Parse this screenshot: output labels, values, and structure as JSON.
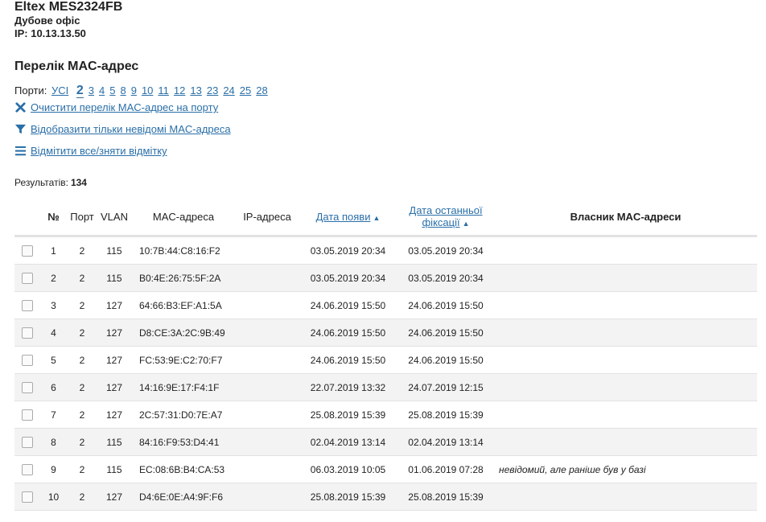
{
  "device": {
    "name": "Eltex MES2324FB",
    "office": "Дубове офіс",
    "ip": "IP: 10.13.13.50"
  },
  "section_title": "Перелік MAC-адрес",
  "ports": {
    "label": "Порти:",
    "all": "УСІ",
    "items": [
      "2",
      "3",
      "4",
      "5",
      "8",
      "9",
      "10",
      "11",
      "12",
      "13",
      "23",
      "24",
      "25",
      "28"
    ]
  },
  "actions": {
    "clear": "Очистити перелік MAC-адрес на порту",
    "filter_unknown": "Відобразити тільки невідомі MAC-адреса",
    "toggle_all": "Відмітити все/зняти відмітку"
  },
  "results": {
    "label": "Результатів:",
    "count": "134"
  },
  "table": {
    "headers": {
      "num": "№",
      "port": "Порт",
      "vlan": "VLAN",
      "mac": "MAC-адреса",
      "ip": "IP-адреса",
      "first_seen": "Дата появи",
      "last_seen_1": "Дата останньої",
      "last_seen_2": "фіксації",
      "owner": "Власник MAC-адреси"
    },
    "rows": [
      {
        "n": "1",
        "port": "2",
        "vlan": "115",
        "mac": "10:7B:44:C8:16:F2",
        "ip": "",
        "first": "03.05.2019 20:34",
        "last": "03.05.2019 20:34",
        "owner": ""
      },
      {
        "n": "2",
        "port": "2",
        "vlan": "115",
        "mac": "B0:4E:26:75:5F:2A",
        "ip": "",
        "first": "03.05.2019 20:34",
        "last": "03.05.2019 20:34",
        "owner": ""
      },
      {
        "n": "3",
        "port": "2",
        "vlan": "127",
        "mac": "64:66:B3:EF:A1:5A",
        "ip": "",
        "first": "24.06.2019 15:50",
        "last": "24.06.2019 15:50",
        "owner": ""
      },
      {
        "n": "4",
        "port": "2",
        "vlan": "127",
        "mac": "D8:CE:3A:2C:9B:49",
        "ip": "",
        "first": "24.06.2019 15:50",
        "last": "24.06.2019 15:50",
        "owner": ""
      },
      {
        "n": "5",
        "port": "2",
        "vlan": "127",
        "mac": "FC:53:9E:C2:70:F7",
        "ip": "",
        "first": "24.06.2019 15:50",
        "last": "24.06.2019 15:50",
        "owner": ""
      },
      {
        "n": "6",
        "port": "2",
        "vlan": "127",
        "mac": "14:16:9E:17:F4:1F",
        "ip": "",
        "first": "22.07.2019 13:32",
        "last": "24.07.2019 12:15",
        "owner": ""
      },
      {
        "n": "7",
        "port": "2",
        "vlan": "127",
        "mac": "2C:57:31:D0:7E:A7",
        "ip": "",
        "first": "25.08.2019 15:39",
        "last": "25.08.2019 15:39",
        "owner": ""
      },
      {
        "n": "8",
        "port": "2",
        "vlan": "115",
        "mac": "84:16:F9:53:D4:41",
        "ip": "",
        "first": "02.04.2019 13:14",
        "last": "02.04.2019 13:14",
        "owner": ""
      },
      {
        "n": "9",
        "port": "2",
        "vlan": "115",
        "mac": "EC:08:6B:B4:CA:53",
        "ip": "",
        "first": "06.03.2019 10:05",
        "last": "01.06.2019 07:28",
        "owner": "невідомий, але раніше був у базі"
      },
      {
        "n": "10",
        "port": "2",
        "vlan": "127",
        "mac": "D4:6E:0E:A4:9F:F6",
        "ip": "",
        "first": "25.08.2019 15:39",
        "last": "25.08.2019 15:39",
        "owner": ""
      }
    ]
  },
  "colors": {
    "link": "#2a6fa8",
    "row_alt": "#f3f3f3",
    "border": "#e2e2e2"
  }
}
